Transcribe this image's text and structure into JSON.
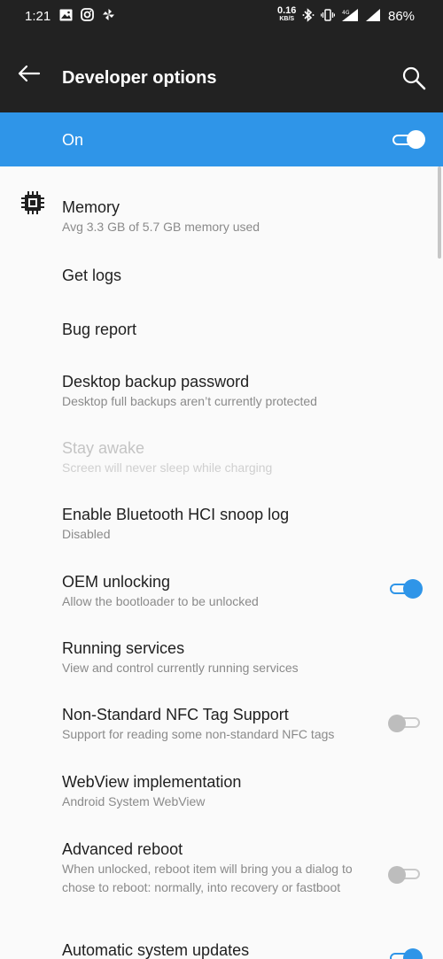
{
  "status_bar": {
    "time": "1:21",
    "net_speed_value": "0.16",
    "net_speed_unit": "KB/S",
    "battery": "86%",
    "left_icons": [
      "gallery-icon",
      "instagram-icon",
      "pinwheel-icon"
    ],
    "right_icons": [
      "bluetooth-icon",
      "vibrate-icon",
      "signal-4g-icon",
      "signal-icon"
    ]
  },
  "app_bar": {
    "title": "Developer options"
  },
  "master_switch": {
    "label": "On",
    "state": "on",
    "color": "#2f95e8"
  },
  "items": [
    {
      "title": "Memory",
      "summary": "Avg 3.3 GB of 5.7 GB memory used",
      "icon": "chip-icon"
    },
    {
      "title": "Get logs"
    },
    {
      "title": "Bug report"
    },
    {
      "title": "Desktop backup password",
      "summary": "Desktop full backups aren’t currently protected"
    },
    {
      "title": "Stay awake",
      "summary": "Screen will never sleep while charging",
      "disabled": true
    },
    {
      "title": "Enable Bluetooth HCI snoop log",
      "summary": "Disabled"
    },
    {
      "title": "OEM unlocking",
      "summary": "Allow the bootloader to be unlocked",
      "switch": "on"
    },
    {
      "title": "Running services",
      "summary": "View and control currently running services"
    },
    {
      "title": "Non-Standard NFC Tag Support",
      "summary": "Support for reading some non-standard NFC tags",
      "switch": "off"
    },
    {
      "title": "WebView implementation",
      "summary": "Android System WebView"
    },
    {
      "title": "Advanced reboot",
      "summary": "When unlocked, reboot item will bring you a dialog to chose to reboot: normally, into recovery or fastboot",
      "switch": "off"
    },
    {
      "title": "Automatic system updates",
      "switch": "on"
    }
  ]
}
